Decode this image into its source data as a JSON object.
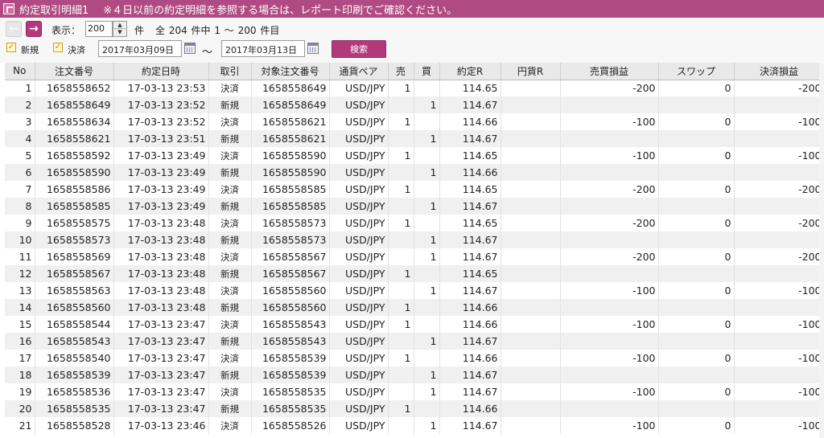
{
  "title": {
    "main": "約定取引明細1",
    "note": "※４日以前の約定明細を参照する場合は、レポート印刷でご確認ください。"
  },
  "toolbar": {
    "display_label": "表示：",
    "display_value": "200",
    "count_unit": "件",
    "summary": "全 204 件中 1 ～ 200 件目",
    "filter_new_label": "新規",
    "filter_settle_label": "決済",
    "date_from": "2017年03月09日",
    "date_sep": "～",
    "date_to": "2017年03月13日",
    "search_label": "検索",
    "prev_icon": "arrow-left-icon",
    "next_icon": "arrow-right-icon"
  },
  "table": {
    "headers": [
      "No",
      "注文番号",
      "約定日時",
      "取引",
      "対象注文番号",
      "通貨ペア",
      "売",
      "買",
      "約定R",
      "円貨R",
      "売買損益",
      "スワップ",
      "決済損益"
    ],
    "rows": [
      [
        "1",
        "1658558652",
        "17-03-13 23:53",
        "決済",
        "1658558649",
        "USD/JPY",
        "1",
        "",
        "114.65",
        "",
        "-200",
        "0",
        "-200"
      ],
      [
        "2",
        "1658558649",
        "17-03-13 23:52",
        "新規",
        "1658558649",
        "USD/JPY",
        "",
        "1",
        "114.67",
        "",
        "",
        "",
        ""
      ],
      [
        "3",
        "1658558634",
        "17-03-13 23:52",
        "決済",
        "1658558621",
        "USD/JPY",
        "1",
        "",
        "114.66",
        "",
        "-100",
        "0",
        "-100"
      ],
      [
        "4",
        "1658558621",
        "17-03-13 23:51",
        "新規",
        "1658558621",
        "USD/JPY",
        "",
        "1",
        "114.67",
        "",
        "",
        "",
        ""
      ],
      [
        "5",
        "1658558592",
        "17-03-13 23:49",
        "決済",
        "1658558590",
        "USD/JPY",
        "1",
        "",
        "114.65",
        "",
        "-100",
        "0",
        "-100"
      ],
      [
        "6",
        "1658558590",
        "17-03-13 23:49",
        "新規",
        "1658558590",
        "USD/JPY",
        "",
        "1",
        "114.66",
        "",
        "",
        "",
        ""
      ],
      [
        "7",
        "1658558586",
        "17-03-13 23:49",
        "決済",
        "1658558585",
        "USD/JPY",
        "1",
        "",
        "114.65",
        "",
        "-200",
        "0",
        "-200"
      ],
      [
        "8",
        "1658558585",
        "17-03-13 23:49",
        "新規",
        "1658558585",
        "USD/JPY",
        "",
        "1",
        "114.67",
        "",
        "",
        "",
        ""
      ],
      [
        "9",
        "1658558575",
        "17-03-13 23:48",
        "決済",
        "1658558573",
        "USD/JPY",
        "1",
        "",
        "114.65",
        "",
        "-200",
        "0",
        "-200"
      ],
      [
        "10",
        "1658558573",
        "17-03-13 23:48",
        "新規",
        "1658558573",
        "USD/JPY",
        "",
        "1",
        "114.67",
        "",
        "",
        "",
        ""
      ],
      [
        "11",
        "1658558569",
        "17-03-13 23:48",
        "決済",
        "1658558567",
        "USD/JPY",
        "",
        "1",
        "114.67",
        "",
        "-200",
        "0",
        "-200"
      ],
      [
        "12",
        "1658558567",
        "17-03-13 23:48",
        "新規",
        "1658558567",
        "USD/JPY",
        "1",
        "",
        "114.65",
        "",
        "",
        "",
        ""
      ],
      [
        "13",
        "1658558563",
        "17-03-13 23:48",
        "決済",
        "1658558560",
        "USD/JPY",
        "",
        "1",
        "114.67",
        "",
        "-100",
        "0",
        "-100"
      ],
      [
        "14",
        "1658558560",
        "17-03-13 23:48",
        "新規",
        "1658558560",
        "USD/JPY",
        "1",
        "",
        "114.66",
        "",
        "",
        "",
        ""
      ],
      [
        "15",
        "1658558544",
        "17-03-13 23:47",
        "決済",
        "1658558543",
        "USD/JPY",
        "1",
        "",
        "114.66",
        "",
        "-100",
        "0",
        "-100"
      ],
      [
        "16",
        "1658558543",
        "17-03-13 23:47",
        "新規",
        "1658558543",
        "USD/JPY",
        "",
        "1",
        "114.67",
        "",
        "",
        "",
        ""
      ],
      [
        "17",
        "1658558540",
        "17-03-13 23:47",
        "決済",
        "1658558539",
        "USD/JPY",
        "1",
        "",
        "114.66",
        "",
        "-100",
        "0",
        "-100"
      ],
      [
        "18",
        "1658558539",
        "17-03-13 23:47",
        "新規",
        "1658558539",
        "USD/JPY",
        "",
        "1",
        "114.67",
        "",
        "",
        "",
        ""
      ],
      [
        "19",
        "1658558536",
        "17-03-13 23:47",
        "決済",
        "1658558535",
        "USD/JPY",
        "",
        "1",
        "114.67",
        "",
        "-100",
        "0",
        "-100"
      ],
      [
        "20",
        "1658558535",
        "17-03-13 23:47",
        "新規",
        "1658558535",
        "USD/JPY",
        "1",
        "",
        "114.66",
        "",
        "",
        "",
        ""
      ],
      [
        "21",
        "1658558528",
        "17-03-13 23:46",
        "決済",
        "1658558526",
        "USD/JPY",
        "",
        "1",
        "114.67",
        "",
        "-100",
        "0",
        "-100"
      ]
    ]
  },
  "colors": {
    "accent": "#b23a7c",
    "title_bar": "#b04a82"
  }
}
